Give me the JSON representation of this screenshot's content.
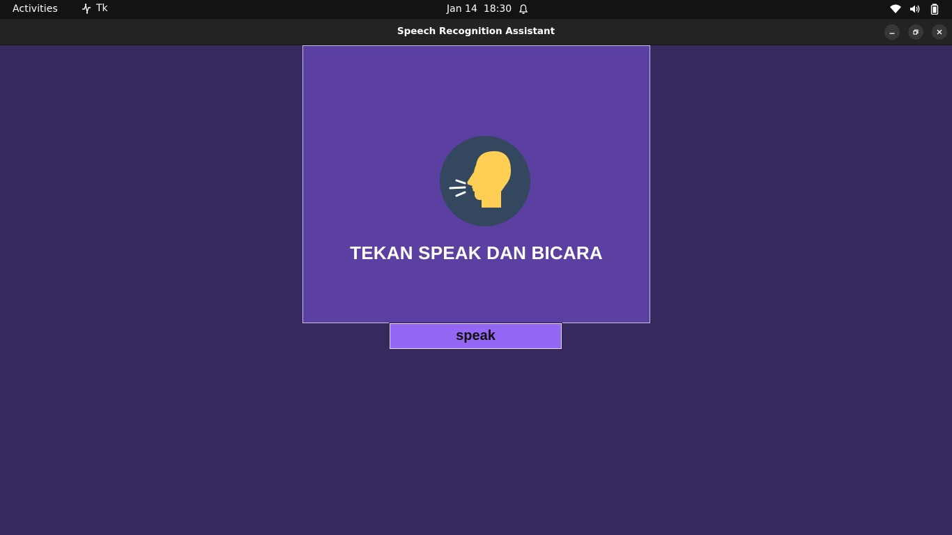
{
  "topbar": {
    "activities_label": "Activities",
    "app_name": "Tk",
    "date": "Jan 14",
    "time": "18:30"
  },
  "window": {
    "title": "Speech Recognition Assistant"
  },
  "main": {
    "instruction_text": "TEKAN SPEAK DAN BICARA",
    "speak_button_label": "speak",
    "icon": "speaking-head-icon"
  },
  "colors": {
    "background": "#35295e",
    "panel": "#5b3fa1",
    "button": "#9467f5",
    "icon_circle": "#33475e",
    "icon_head": "#ffce55"
  }
}
